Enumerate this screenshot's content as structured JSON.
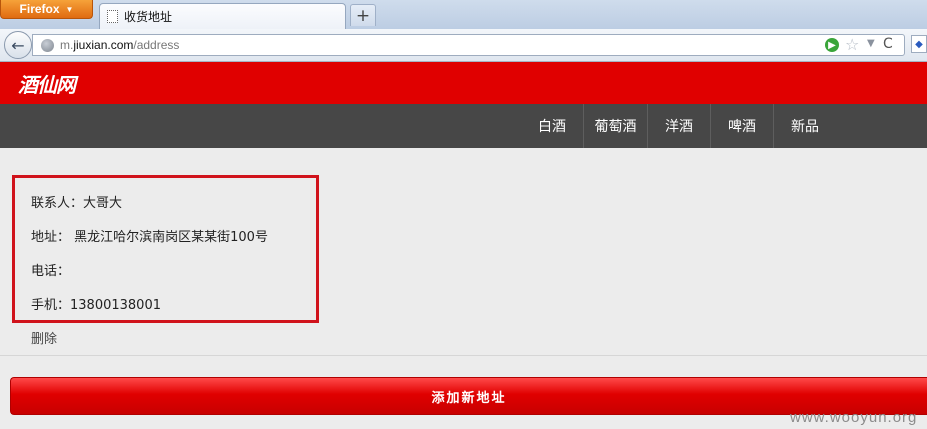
{
  "browser": {
    "menu_button": "Firefox",
    "active_tab_title": "收货地址",
    "new_tab_symbol": "+",
    "back_symbol": "←",
    "url": {
      "prefix": "m.",
      "domain": "jiuxian.com",
      "path": "/address"
    },
    "go_symbol": "▶",
    "star_symbol": "☆",
    "dropdown_symbol": "▼",
    "reload_symbol": "C"
  },
  "site": {
    "logo": "酒仙网",
    "brand_color": "#e00000",
    "nav": [
      {
        "label": "白酒"
      },
      {
        "label": "葡萄酒"
      },
      {
        "label": "洋酒"
      },
      {
        "label": "啤酒"
      },
      {
        "label": "新品"
      }
    ]
  },
  "address": {
    "contact": "联系人：大哥大",
    "address": "地址： 黑龙江哈尔滨南岗区某某街100号",
    "phone": "电话：",
    "mobile": "手机：13800138001",
    "delete_label": "删除"
  },
  "add_button_label": "添加新地址",
  "watermark": "www.wooyun.org"
}
